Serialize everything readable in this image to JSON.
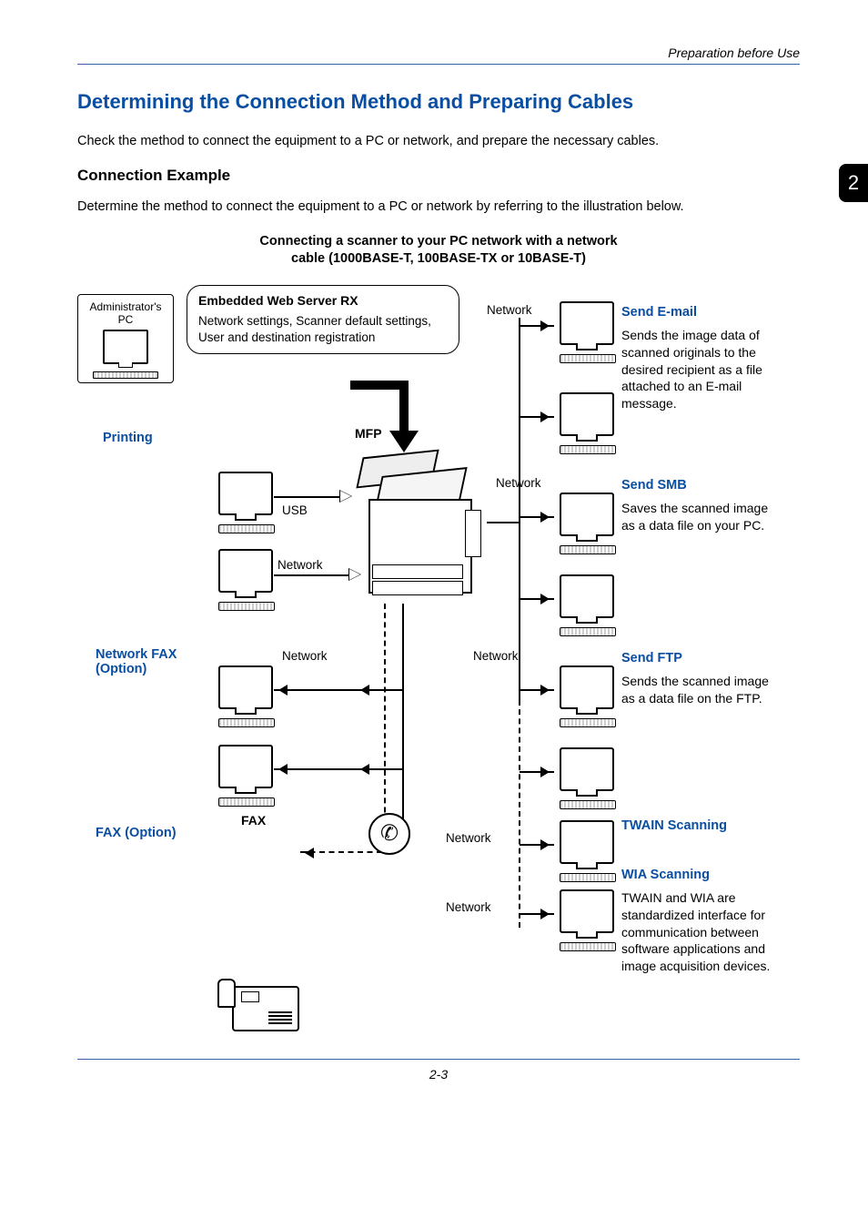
{
  "header": {
    "running": "Preparation before Use"
  },
  "chapter": "2",
  "title": "Determining the Connection Method and Preparing Cables",
  "intro": "Check the method to connect the equipment to a PC or network, and prepare the necessary cables.",
  "subhead": "Connection Example",
  "subtext": "Determine the method to connect the equipment to a PC or network by referring to the illustration below.",
  "diagram_title_l1": "Connecting a scanner to your PC network with a network",
  "diagram_title_l2": "cable (1000BASE-T, 100BASE-TX or 10BASE-T)",
  "callout": {
    "title": "Embedded Web Server RX",
    "desc": "Network settings, Scanner default settings, User and destination registration"
  },
  "admin_label_l1": "Administrator's",
  "admin_label_l2": "PC",
  "labels": {
    "printing": "Printing",
    "mfp": "MFP",
    "usb": "USB",
    "network": "Network",
    "network_fax": "Network FAX (Option)",
    "fax_option": "FAX (Option)",
    "fax": "FAX"
  },
  "right": {
    "send_email": {
      "title": "Send E-mail",
      "desc": "Sends the image data of scanned originals to the desired recipient as a file attached to an E-mail message."
    },
    "send_smb": {
      "title": "Send SMB",
      "desc": "Saves the scanned image as a data file on your PC."
    },
    "send_ftp": {
      "title": "Send FTP",
      "desc": "Sends the scanned image as a data file on the FTP."
    },
    "twain": {
      "title": "TWAIN Scanning"
    },
    "wia": {
      "title": "WIA Scanning",
      "desc": "TWAIN and WIA are standardized interface for communication between software applications and image acquisition devices."
    }
  },
  "footer": {
    "page": "2-3"
  }
}
